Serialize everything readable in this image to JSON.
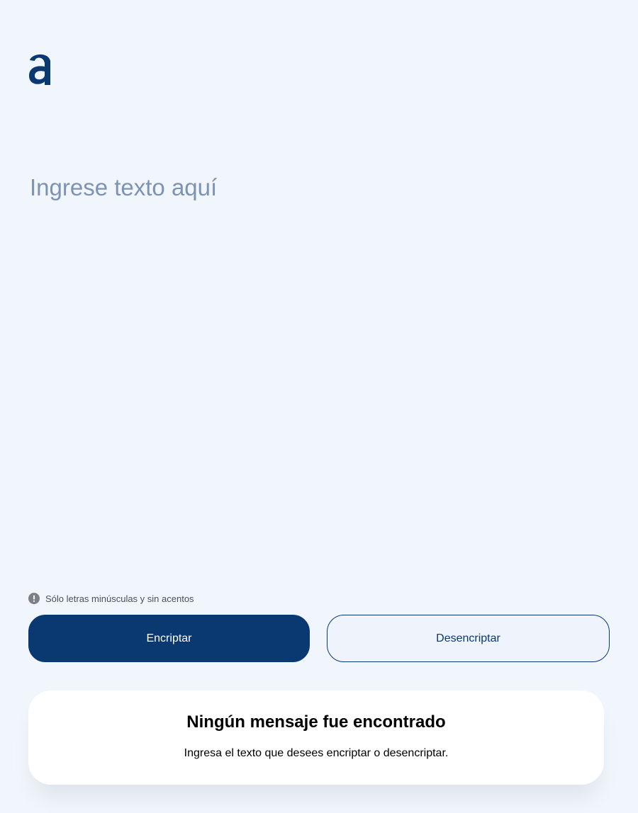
{
  "logo": {
    "icon": "alura-a-logo-icon",
    "color": "#0a3871"
  },
  "input": {
    "placeholder": "Ingrese texto aquí",
    "value": ""
  },
  "hint": {
    "icon": "exclamation-circle-icon",
    "text": "Sólo letras minúsculas y sin acentos"
  },
  "buttons": {
    "encrypt_label": "Encriptar",
    "decrypt_label": "Desencriptar"
  },
  "result": {
    "title": "Ningún mensaje fue encontrado",
    "subtitle": "Ingresa el texto que desees encriptar o desencriptar."
  },
  "colors": {
    "background": "#f1f5fc",
    "primary": "#0a3871",
    "placeholder": "#7e93b3",
    "card": "#ffffff"
  }
}
